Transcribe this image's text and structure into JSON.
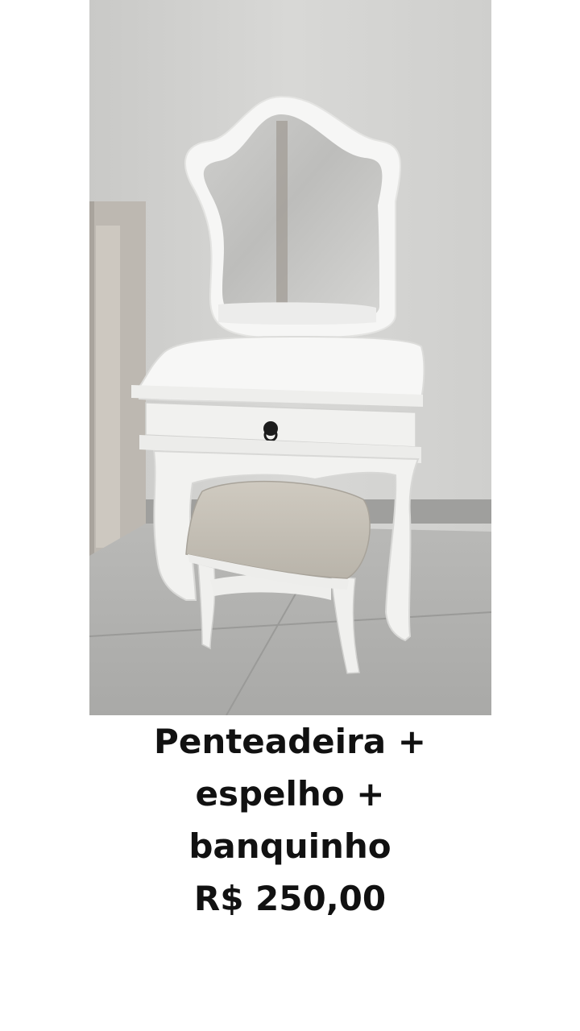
{
  "listing": {
    "title_line1": "Penteadeira +",
    "title_line2": "espelho +",
    "title_line3": "banquinho",
    "price": "R$ 250,00"
  }
}
